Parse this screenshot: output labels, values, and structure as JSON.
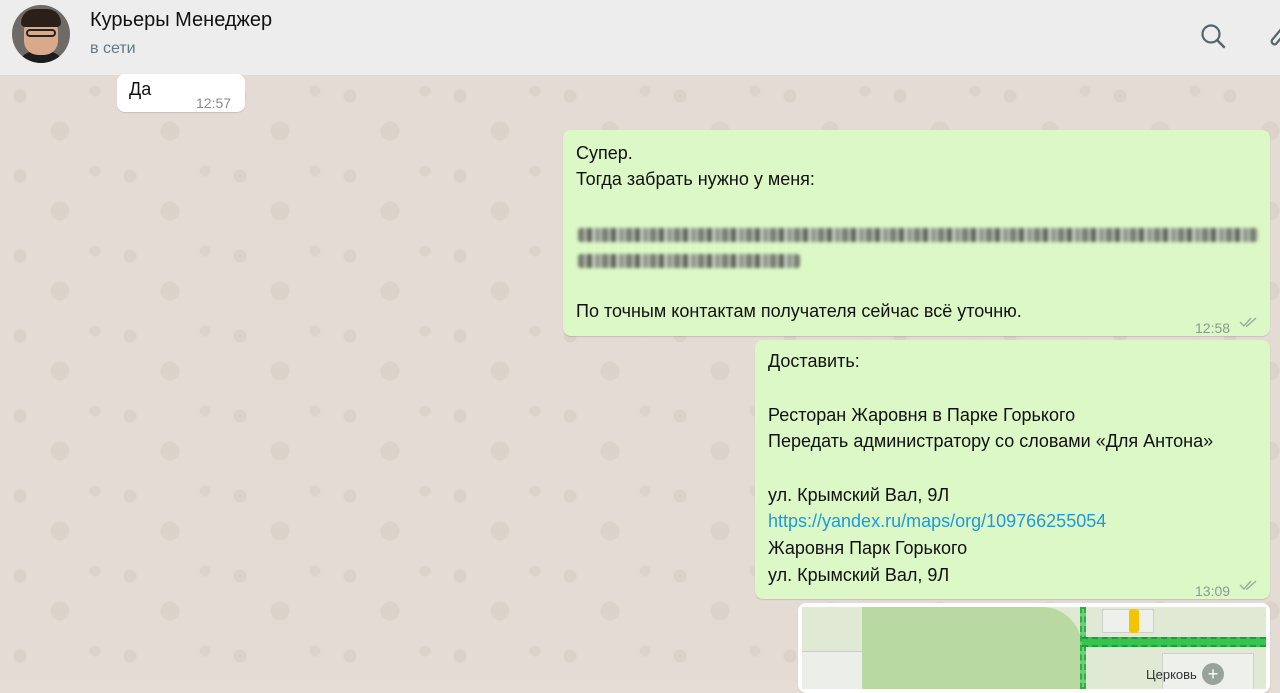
{
  "header": {
    "title": "Курьеры Менеджер",
    "status": "в сети"
  },
  "icons": {
    "search": "search-icon",
    "attach": "paperclip-icon",
    "read": "double-check-icon"
  },
  "colors": {
    "incoming_bubble": "#ffffff",
    "outgoing_bubble": "#dcf8c6",
    "link": "#1e9ad6",
    "chat_background": "#e4dcd4"
  },
  "messages": [
    {
      "direction": "in",
      "lines": [
        "Да"
      ],
      "time": "12:57"
    },
    {
      "direction": "out",
      "lines": [
        "Супер.",
        "Тогда забрать нужно у меня:",
        "",
        "По точным контактам получателя сейчас всё уточню."
      ],
      "time": "12:58",
      "redacted": true
    },
    {
      "direction": "out",
      "lines": [
        "Доставить:",
        "Ресторан Жаровня в Парке Горького",
        "Передать администратору со словами «Для Антона»",
        "ул. Крымский Вал, 9Л",
        "https://yandex.ru/maps/org/109766255054",
        "Жаровня Парк Горького",
        "ул. Крымский Вал, 9Л"
      ],
      "time": "13:09"
    }
  ],
  "map_preview": {
    "label": "Церковь"
  }
}
